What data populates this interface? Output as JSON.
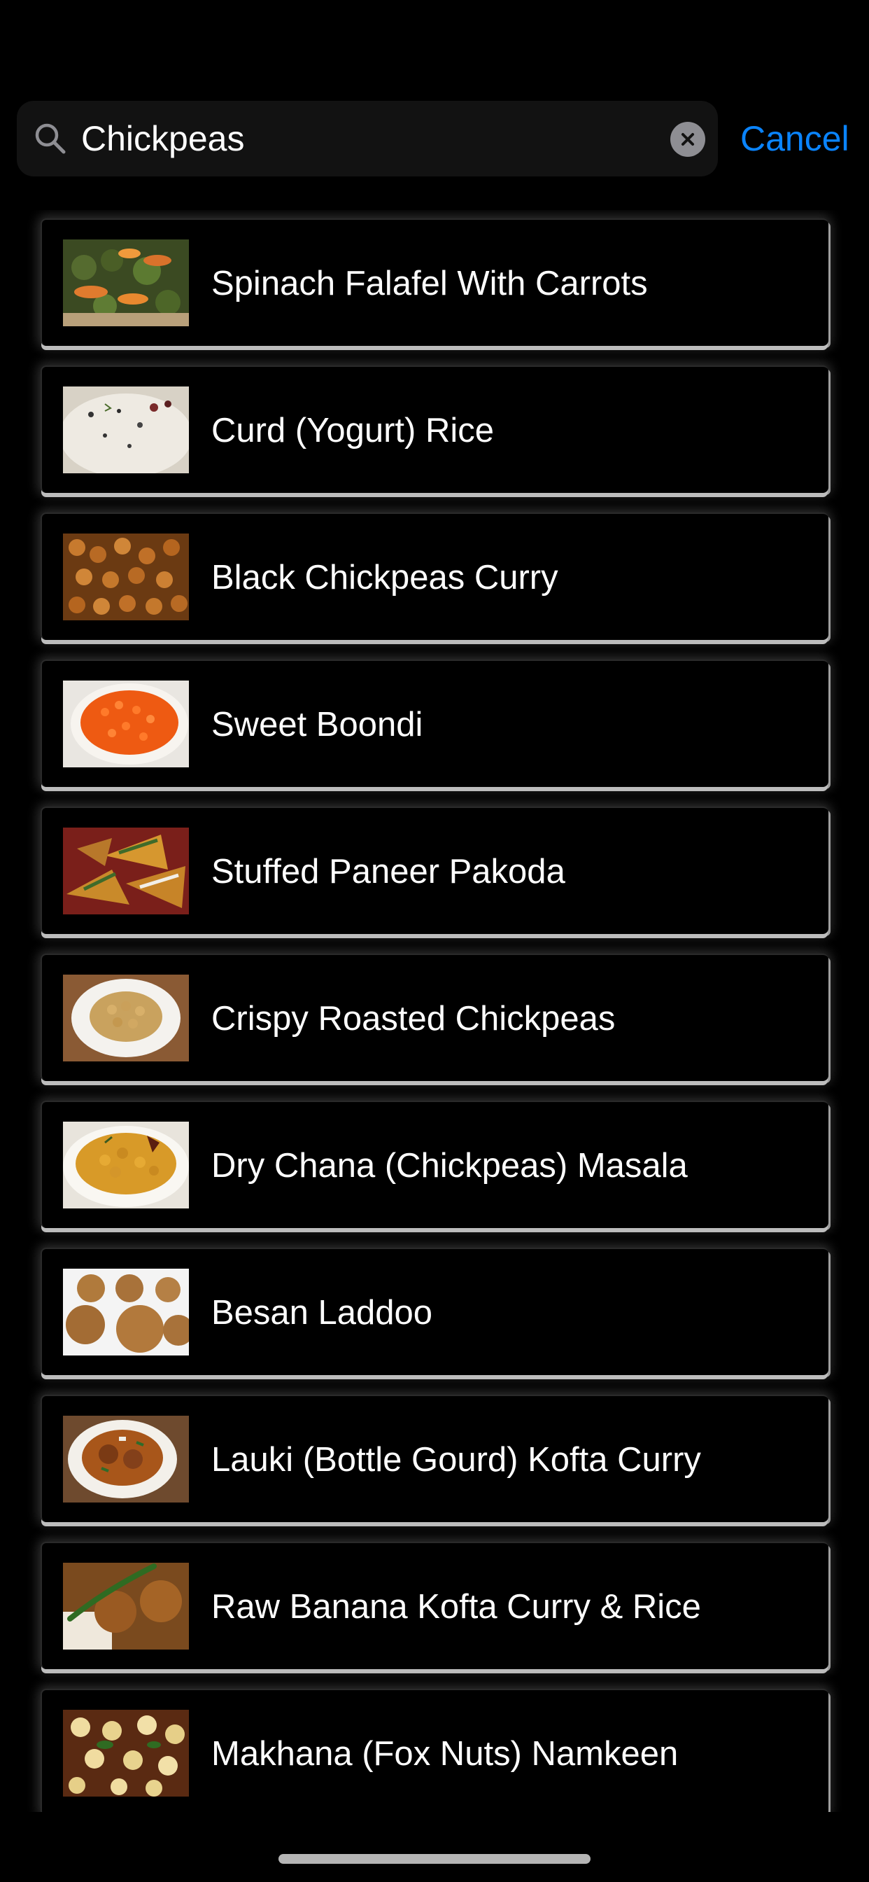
{
  "search": {
    "value": "Chickpeas",
    "cancel_label": "Cancel",
    "search_icon": "magnifier-icon",
    "clear_icon": "clear-x-circle-icon"
  },
  "results": [
    {
      "title": "Spinach Falafel With Carrots",
      "thumb": "falafel"
    },
    {
      "title": "Curd (Yogurt) Rice",
      "thumb": "curd-rice"
    },
    {
      "title": "Black Chickpeas Curry",
      "thumb": "chickpeas-curry"
    },
    {
      "title": "Sweet Boondi",
      "thumb": "boondi"
    },
    {
      "title": "Stuffed Paneer Pakoda",
      "thumb": "pakoda"
    },
    {
      "title": "Crispy Roasted Chickpeas",
      "thumb": "roasted-chickpeas"
    },
    {
      "title": "Dry Chana (Chickpeas) Masala",
      "thumb": "chana-masala"
    },
    {
      "title": "Besan Laddoo",
      "thumb": "laddoo"
    },
    {
      "title": "Lauki (Bottle Gourd) Kofta Curry",
      "thumb": "kofta-curry"
    },
    {
      "title": "Raw Banana Kofta Curry & Rice",
      "thumb": "banana-kofta"
    },
    {
      "title": "Makhana (Fox Nuts) Namkeen",
      "thumb": "makhana"
    }
  ],
  "colors": {
    "background": "#000000",
    "search_field": "#121212",
    "accent": "#0a84ff",
    "text": "#ffffff"
  }
}
